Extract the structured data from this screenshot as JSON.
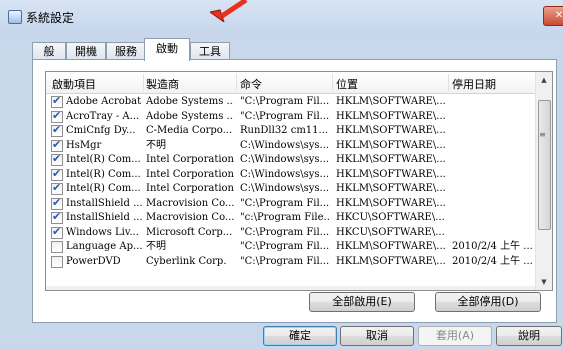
{
  "window": {
    "title": "系統設定",
    "close_glyph": "✕"
  },
  "tabs": [
    {
      "label": "般"
    },
    {
      "label": "開機"
    },
    {
      "label": "服務"
    },
    {
      "label": "啟動"
    },
    {
      "label": "工具"
    }
  ],
  "table": {
    "columns": [
      "啟動項目",
      "製造商",
      "命令",
      "位置",
      "停用日期"
    ],
    "rows": [
      {
        "checked": true,
        "item": "Adobe Acrobat",
        "maker": "Adobe Systems ...",
        "command": "\"C:\\Program Fil...",
        "location": "HKLM\\SOFTWARE\\...",
        "disabled_date": ""
      },
      {
        "checked": true,
        "item": "AcroTray - A...",
        "maker": "Adobe Systems ...",
        "command": "\"C:\\Program Fil...",
        "location": "HKLM\\SOFTWARE\\...",
        "disabled_date": ""
      },
      {
        "checked": true,
        "item": "CmiCnfg Dy...",
        "maker": "C-Media Corpo...",
        "command": "RunDll32 cm11...",
        "location": "HKLM\\SOFTWARE\\...",
        "disabled_date": ""
      },
      {
        "checked": true,
        "item": "HsMgr",
        "maker": "不明",
        "command": "C:\\Windows\\sys...",
        "location": "HKLM\\SOFTWARE\\...",
        "disabled_date": ""
      },
      {
        "checked": true,
        "item": "Intel(R) Com...",
        "maker": "Intel Corporation",
        "command": "C:\\Windows\\sys...",
        "location": "HKLM\\SOFTWARE\\...",
        "disabled_date": ""
      },
      {
        "checked": true,
        "item": "Intel(R) Com...",
        "maker": "Intel Corporation",
        "command": "C:\\Windows\\sys...",
        "location": "HKLM\\SOFTWARE\\...",
        "disabled_date": ""
      },
      {
        "checked": true,
        "item": "Intel(R) Com...",
        "maker": "Intel Corporation",
        "command": "C:\\Windows\\sys...",
        "location": "HKLM\\SOFTWARE\\...",
        "disabled_date": ""
      },
      {
        "checked": true,
        "item": "InstallShield ...",
        "maker": "Macrovision Co...",
        "command": "\"C:\\Program Fil...",
        "location": "HKLM\\SOFTWARE\\...",
        "disabled_date": ""
      },
      {
        "checked": true,
        "item": "InstallShield ...",
        "maker": "Macrovision Co...",
        "command": "\"c:\\Program File...",
        "location": "HKCU\\SOFTWARE\\...",
        "disabled_date": ""
      },
      {
        "checked": true,
        "item": "Windows Liv...",
        "maker": "Microsoft Corp...",
        "command": "\"C:\\Program Fil...",
        "location": "HKCU\\SOFTWARE\\...",
        "disabled_date": ""
      },
      {
        "checked": false,
        "item": "Language Ap...",
        "maker": "不明",
        "command": "\"C:\\Program Fil...",
        "location": "HKLM\\SOFTWARE\\...",
        "disabled_date": "2010/2/4 上午 ..."
      },
      {
        "checked": false,
        "item": "PowerDVD",
        "maker": "Cyberlink Corp.",
        "command": "\"C:\\Program Fil...",
        "location": "HKLM\\SOFTWARE\\...",
        "disabled_date": "2010/2/4 上午 ..."
      }
    ]
  },
  "panel_buttons": {
    "enable_all": "全部啟用(E)",
    "disable_all": "全部停用(D)"
  },
  "dialog_buttons": {
    "ok": "確定",
    "cancel": "取消",
    "apply": "套用(A)",
    "help": "說明"
  },
  "icons": {
    "check": "✔",
    "scroll_up": "▲",
    "scroll_down": "▼",
    "thumb_grip": "≡"
  },
  "colors": {
    "accent_arrow": "#e8321e",
    "check_color": "#2a5bb5"
  }
}
